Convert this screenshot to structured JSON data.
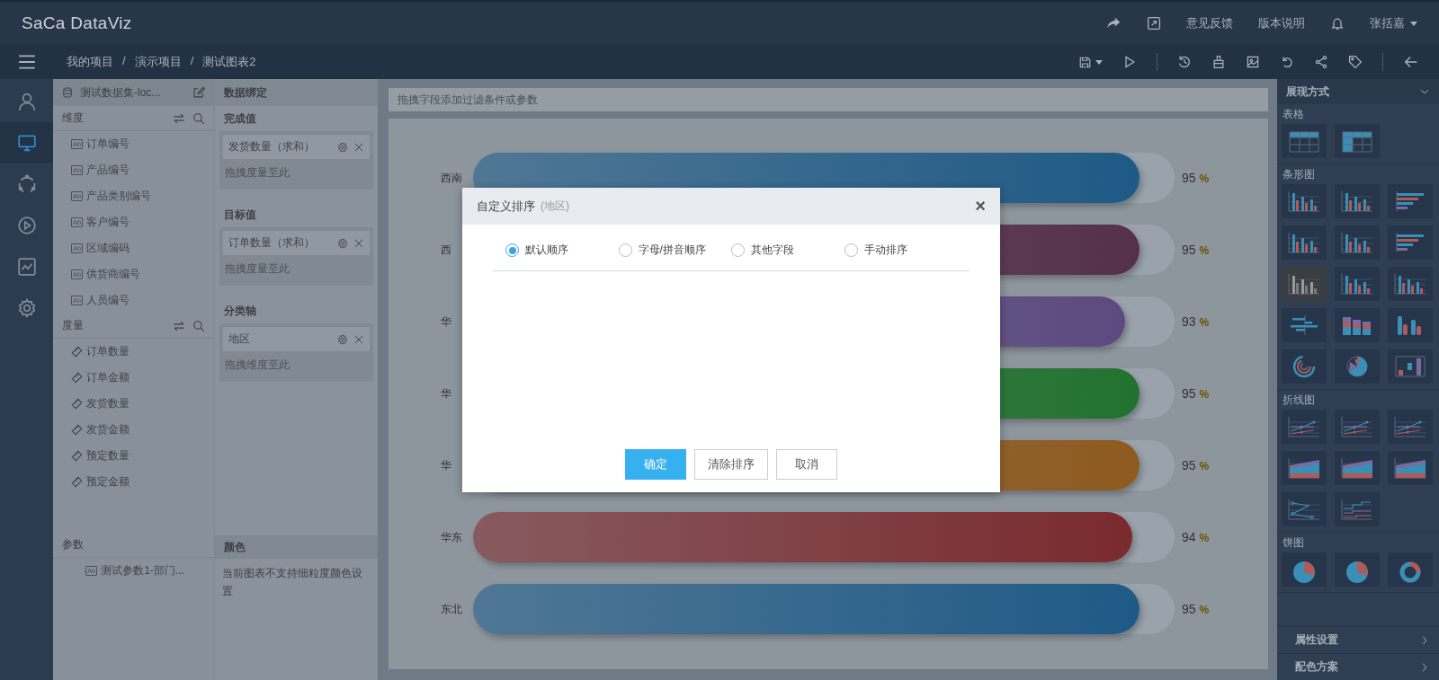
{
  "top_bar": {
    "logo": "SaCa DataViz",
    "links": [
      "意见反馈",
      "版本说明"
    ],
    "user": "张括嘉"
  },
  "breadcrumb": {
    "items": [
      "我的项目",
      "演示项目",
      "测试图表2"
    ],
    "separator": "/"
  },
  "nav_rail": [
    {
      "kind": "user",
      "selected": false
    },
    {
      "kind": "monitor",
      "selected": true
    },
    {
      "kind": "cycle",
      "selected": false
    },
    {
      "kind": "play",
      "selected": false
    },
    {
      "kind": "chart",
      "selected": false
    },
    {
      "kind": "settings",
      "selected": false
    }
  ],
  "dataset_panel": {
    "title": "测试数据集-loc...",
    "dimensions": {
      "title": "维度",
      "items": [
        {
          "badge": "Ab",
          "label": "订单编号"
        },
        {
          "badge": "Ab",
          "label": "产品编号"
        },
        {
          "badge": "Ab",
          "label": "产品类别编号"
        },
        {
          "badge": "Ab",
          "label": "客户编号"
        },
        {
          "badge": "Ab",
          "label": "区域编码"
        },
        {
          "badge": "Ab",
          "label": "供货商编号"
        },
        {
          "badge": "Ab",
          "label": "人员编号"
        }
      ]
    },
    "measures": {
      "title": "度量",
      "items": [
        "订单数量",
        "订单金额",
        "发货数量",
        "发货金额",
        "预定数量",
        "预定金额"
      ]
    },
    "parameters": {
      "title": "参数",
      "items": [
        {
          "badge": "Ab",
          "label": "测试参数1-部门..."
        }
      ]
    }
  },
  "binding_panel": {
    "title": "数据绑定",
    "slots": [
      {
        "title": "完成值",
        "chip": "发货数量（求和）",
        "placeholder": "拖拽度量至此"
      },
      {
        "title": "目标值",
        "chip": "订单数量（求和）",
        "placeholder": "拖拽度量至此"
      },
      {
        "title": "分类轴",
        "chip": "地区",
        "placeholder": "拖拽维度至此"
      }
    ],
    "color": {
      "title": "颜色",
      "note": "当前图表不支持细粒度颜色设置"
    }
  },
  "filter_bar": {
    "placeholder": "拖拽字段添加过滤条件或参数"
  },
  "chart_rows": [
    {
      "label": "西南",
      "value": "95",
      "unit": "%",
      "level": 0.95,
      "color": "#1e5a86"
    },
    {
      "label": "西",
      "value": "95",
      "unit": "%",
      "level": 0.95,
      "color": "#55304a"
    },
    {
      "label": "华",
      "value": "93",
      "unit": "%",
      "level": 0.93,
      "color": "#5d4a80"
    },
    {
      "label": "华",
      "value": "95",
      "unit": "%",
      "level": 0.95,
      "color": "#22722f"
    },
    {
      "label": "华",
      "value": "95",
      "unit": "%",
      "level": 0.95,
      "color": "#8e5a1f"
    },
    {
      "label": "华东",
      "value": "94",
      "unit": "%",
      "level": 0.94,
      "color": "#7a2a2d"
    },
    {
      "label": "东北",
      "value": "95",
      "unit": "%",
      "level": 0.95,
      "color": "#1e5a86"
    }
  ],
  "right_panel": {
    "title": "展现方式",
    "groups": [
      {
        "title": "表格",
        "items": [
          {
            "kind": "table",
            "selected": false
          },
          {
            "kind": "crosstab",
            "selected": false
          }
        ]
      },
      {
        "title": "条形图",
        "items": [
          {
            "kind": "column",
            "selected": false
          },
          {
            "kind": "column",
            "selected": false
          },
          {
            "kind": "hbar",
            "selected": false
          },
          {
            "kind": "column",
            "selected": false
          },
          {
            "kind": "column",
            "selected": false
          },
          {
            "kind": "hbar",
            "selected": false
          },
          {
            "kind": "column",
            "selected": true
          },
          {
            "kind": "column",
            "selected": false
          },
          {
            "kind": "column",
            "selected": false
          },
          {
            "kind": "gantt",
            "selected": false
          },
          {
            "kind": "column3d",
            "selected": false
          },
          {
            "kind": "cylinder",
            "selected": false
          },
          {
            "kind": "radial",
            "selected": false
          },
          {
            "kind": "polar",
            "selected": false
          },
          {
            "kind": "waterfall",
            "selected": false
          }
        ]
      },
      {
        "title": "折线图",
        "items": [
          {
            "kind": "line",
            "selected": false
          },
          {
            "kind": "line",
            "selected": false
          },
          {
            "kind": "line",
            "selected": false
          },
          {
            "kind": "area",
            "selected": false
          },
          {
            "kind": "area",
            "selected": false
          },
          {
            "kind": "area",
            "selected": false
          },
          {
            "kind": "slope",
            "selected": false
          },
          {
            "kind": "step",
            "selected": false
          }
        ]
      },
      {
        "title": "饼图",
        "items": [
          {
            "kind": "pie",
            "selected": false
          },
          {
            "kind": "pie",
            "selected": false
          },
          {
            "kind": "donut",
            "selected": false
          }
        ]
      }
    ],
    "footer": [
      "属性设置",
      "配色方案"
    ]
  },
  "dialog": {
    "title": "自定义排序",
    "subtitle": "(地区)",
    "close": "×",
    "options": [
      {
        "label": "默认顺序",
        "selected": true
      },
      {
        "label": "字母/拼音顺序",
        "selected": false
      },
      {
        "label": "其他字段",
        "selected": false
      },
      {
        "label": "手动排序",
        "selected": false
      }
    ],
    "buttons": [
      {
        "label": "确定",
        "kind": "primary"
      },
      {
        "label": "清除排序",
        "kind": "default"
      },
      {
        "label": "取消",
        "kind": "default"
      }
    ]
  }
}
